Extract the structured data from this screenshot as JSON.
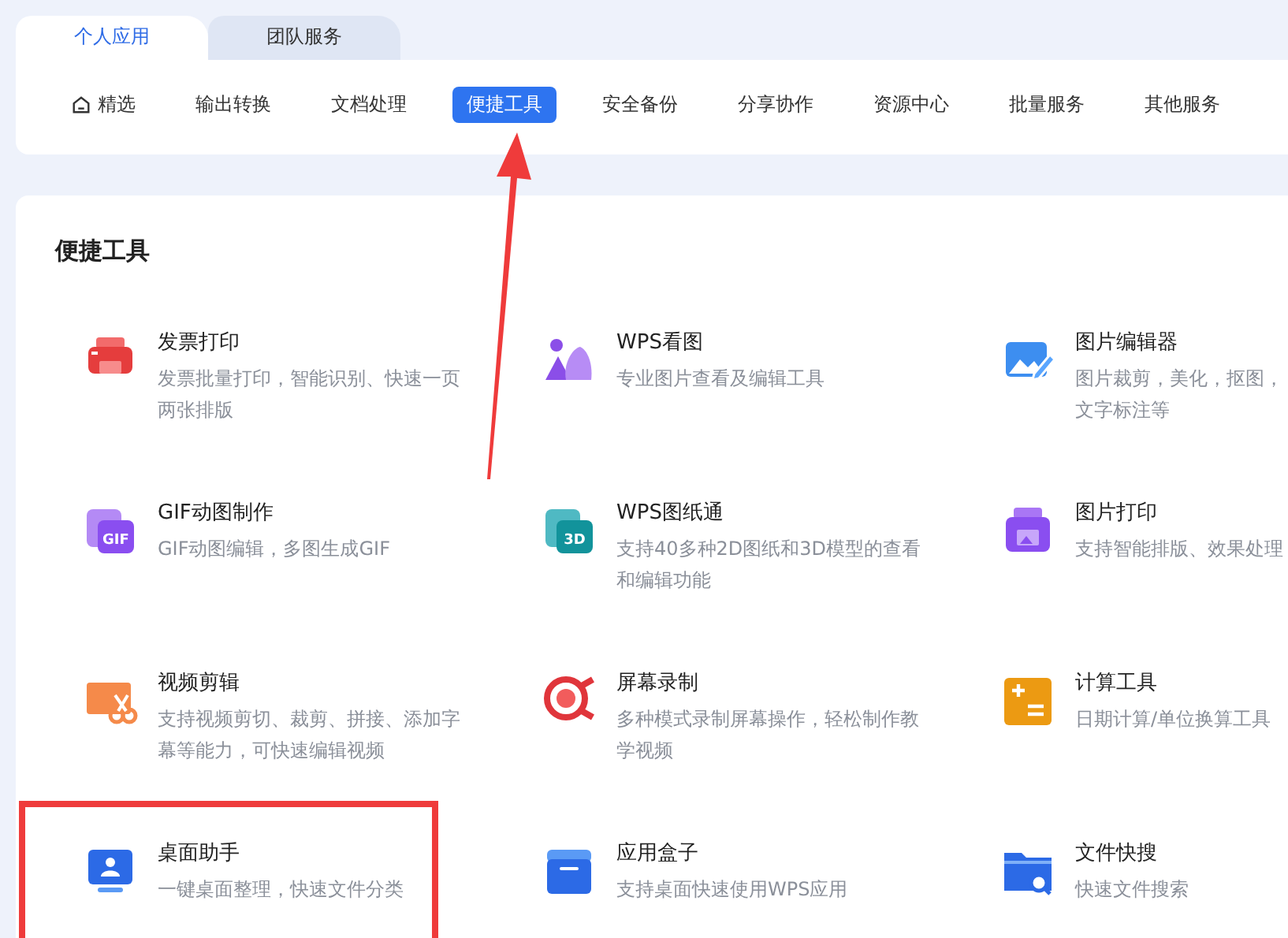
{
  "tabs": [
    {
      "label": "个人应用",
      "selected": true
    },
    {
      "label": "团队服务",
      "selected": false
    }
  ],
  "categories": [
    {
      "label": "精选",
      "selected": false,
      "kind": "home"
    },
    {
      "label": "输出转换",
      "selected": false,
      "kind": "plain"
    },
    {
      "label": "文档处理",
      "selected": false,
      "kind": "plain"
    },
    {
      "label": "便捷工具",
      "selected": true,
      "kind": "plain"
    },
    {
      "label": "安全备份",
      "selected": false,
      "kind": "plain"
    },
    {
      "label": "分享协作",
      "selected": false,
      "kind": "plain"
    },
    {
      "label": "资源中心",
      "selected": false,
      "kind": "plain"
    },
    {
      "label": "批量服务",
      "selected": false,
      "kind": "plain"
    },
    {
      "label": "其他服务",
      "selected": false,
      "kind": "plain"
    }
  ],
  "section": {
    "title": "便捷工具",
    "tools": [
      {
        "name": "发票打印",
        "description": "发票批量打印，智能识别、快速一页两张排版",
        "kind": "printer"
      },
      {
        "name": "WPS看图",
        "description": "专业图片查看及编辑工具",
        "kind": "viewer"
      },
      {
        "name": "图片编辑器",
        "description": "图片裁剪，美化，抠图，文字标注等",
        "kind": "editor"
      },
      {
        "name": "GIF动图制作",
        "description": "GIF动图编辑，多图生成GIF",
        "kind": "gif",
        "icon_text": "GIF"
      },
      {
        "name": "WPS图纸通",
        "description": "支持40多种2D图纸和3D模型的查看和编辑功能",
        "kind": "cad",
        "icon_text": "3D"
      },
      {
        "name": "图片打印",
        "description": "支持智能排版、效果处理",
        "kind": "photoprint"
      },
      {
        "name": "视频剪辑",
        "description": "支持视频剪切、裁剪、拼接、添加字幕等能力，可快速编辑视频",
        "kind": "video"
      },
      {
        "name": "屏幕录制",
        "description": "多种模式录制屏幕操作，轻松制作教学视频",
        "kind": "record"
      },
      {
        "name": "计算工具",
        "description": "日期计算/单位换算工具",
        "kind": "calc"
      },
      {
        "name": "桌面助手",
        "description": "一键桌面整理，快速文件分类",
        "kind": "desktop"
      },
      {
        "name": "应用盒子",
        "description": "支持桌面快速使用WPS应用",
        "kind": "box"
      },
      {
        "name": "文件快搜",
        "description": "快速文件搜索",
        "kind": "search"
      }
    ]
  }
}
